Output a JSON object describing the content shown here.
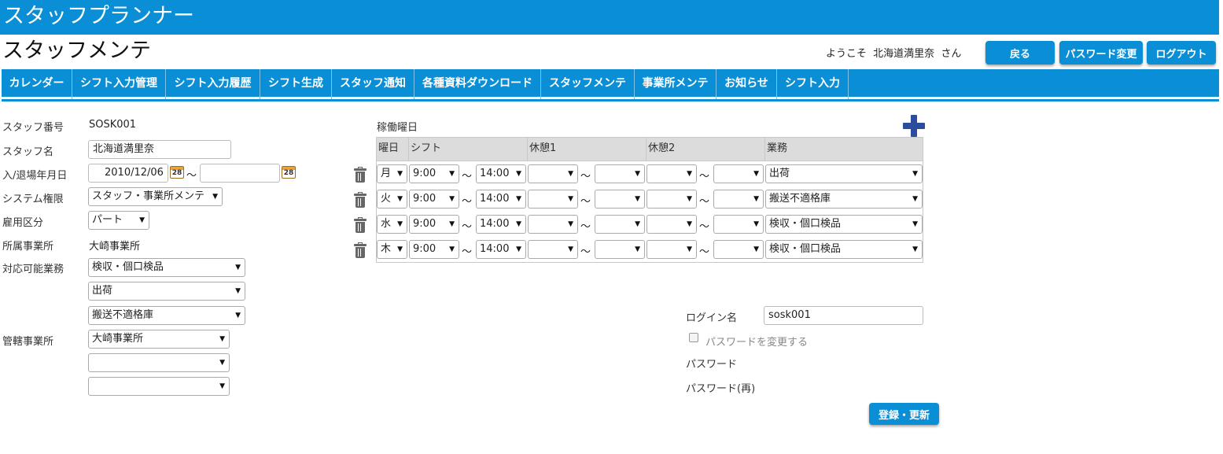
{
  "app": {
    "title": "スタッフプランナー"
  },
  "page": {
    "title": "スタッフメンテ"
  },
  "header": {
    "welcome_prefix": "ようこそ",
    "user_name": "北海道満里奈",
    "welcome_suffix": "さん",
    "back_label": "戻る",
    "password_change_label": "パスワード変更",
    "logout_label": "ログアウト"
  },
  "nav": {
    "items": [
      "カレンダー",
      "シフト入力管理",
      "シフト入力履歴",
      "シフト生成",
      "スタッフ通知",
      "各種資料ダウンロード",
      "スタッフメンテ",
      "事業所メンテ",
      "お知らせ",
      "シフト入力"
    ]
  },
  "form": {
    "staff_no_label": "スタッフ番号",
    "staff_no_value": "SOSK001",
    "staff_name_label": "スタッフ名",
    "staff_name_value": "北海道満里奈",
    "dates_label": "入/退場年月日",
    "start_date": "2010/12/06",
    "end_date": "",
    "date_sep": "～",
    "calendar_day": "28",
    "system_role_label": "システム権限",
    "system_role_value": "スタッフ・事業所メンテ",
    "employment_label": "雇用区分",
    "employment_value": "パート",
    "office_label": "所属事業所",
    "office_value": "大崎事業所",
    "tasks_label": "対応可能業務",
    "tasks": [
      "検収・個口検品",
      "出荷",
      "搬送不適格庫"
    ],
    "managed_label": "管轄事業所",
    "managed_offices": [
      "大崎事業所",
      "",
      ""
    ]
  },
  "schedule": {
    "section_label": "稼働曜日",
    "headers": {
      "day": "曜日",
      "shift": "シフト",
      "break1": "休憩1",
      "break2": "休憩2",
      "task": "業務"
    },
    "tilde": "～",
    "rows": [
      {
        "day": "月",
        "start": "9:00",
        "end": "14:00",
        "b1s": "",
        "b1e": "",
        "b2s": "",
        "b2e": "",
        "task": "出荷"
      },
      {
        "day": "火",
        "start": "9:00",
        "end": "14:00",
        "b1s": "",
        "b1e": "",
        "b2s": "",
        "b2e": "",
        "task": "搬送不適格庫"
      },
      {
        "day": "水",
        "start": "9:00",
        "end": "14:00",
        "b1s": "",
        "b1e": "",
        "b2s": "",
        "b2e": "",
        "task": "検収・個口検品"
      },
      {
        "day": "木",
        "start": "9:00",
        "end": "14:00",
        "b1s": "",
        "b1e": "",
        "b2s": "",
        "b2e": "",
        "task": "検収・個口検品"
      }
    ]
  },
  "login": {
    "login_name_label": "ログイン名",
    "login_name_value": "sosk001",
    "change_password_label": "パスワードを変更する",
    "password_label": "パスワード",
    "password_confirm_label": "パスワード(再)",
    "submit_label": "登録・更新"
  },
  "colors": {
    "brand": "#0a8fd6",
    "plus": "#2b4e9c",
    "header_bg": "#dcdcdc"
  }
}
